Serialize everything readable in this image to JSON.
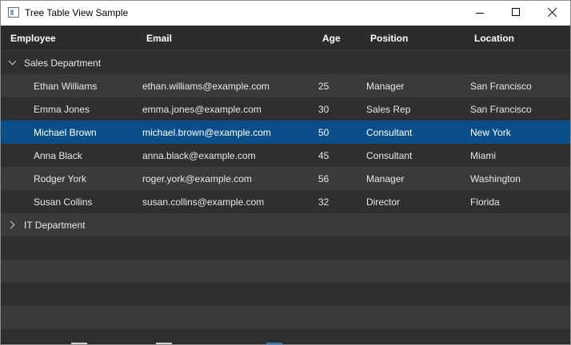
{
  "window": {
    "title": "Tree Table View Sample"
  },
  "columns": [
    "Employee",
    "Email",
    "Age",
    "Position",
    "Location"
  ],
  "groups": [
    {
      "name": "Sales Department",
      "expanded": true,
      "employees": [
        {
          "name": "Ethan Williams",
          "email": "ethan.williams@example.com",
          "age": "25",
          "position": "Manager",
          "location": "San Francisco"
        },
        {
          "name": "Emma Jones",
          "email": "emma.jones@example.com",
          "age": "30",
          "position": "Sales Rep",
          "location": "San Francisco"
        },
        {
          "name": "Michael Brown",
          "email": "michael.brown@example.com",
          "age": "50",
          "position": "Consultant",
          "location": "New York",
          "selected": true
        },
        {
          "name": "Anna Black",
          "email": "anna.black@example.com",
          "age": "45",
          "position": "Consultant",
          "location": "Miami"
        },
        {
          "name": "Rodger York",
          "email": "roger.york@example.com",
          "age": "56",
          "position": "Manager",
          "location": "Washington"
        },
        {
          "name": "Susan Collins",
          "email": "susan.collins@example.com",
          "age": "32",
          "position": "Director",
          "location": "Florida"
        }
      ]
    },
    {
      "name": "IT Department",
      "expanded": false,
      "employees": []
    }
  ],
  "colors": {
    "background": "#2b2b2b",
    "row_even": "#2f2f2f",
    "row_odd": "#3a3a3a",
    "selected": "#0b4f8a"
  }
}
